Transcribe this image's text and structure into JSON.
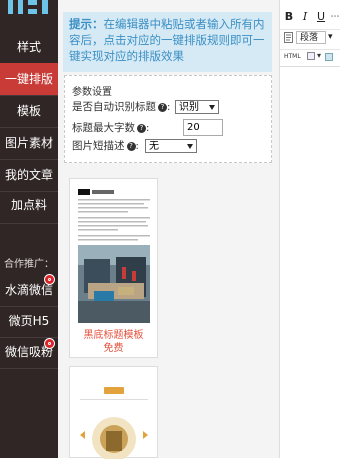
{
  "sidebar": {
    "nav": [
      "样式",
      "一键排版",
      "模板",
      "图片素材",
      "我的文章",
      "加点料"
    ],
    "active_index": 1,
    "partner_label": "合作推广：",
    "promos": [
      "水滴微信",
      "微页H5",
      "微信吸粉"
    ]
  },
  "tip": {
    "bold": "提示：",
    "text": "在编辑器中粘贴或者输入所有内容后，点击对应的一键排版规则即可一键实现对应的排版效果"
  },
  "params": {
    "title": "参数设置",
    "auto_title_label": "是否自动识别标题",
    "auto_title_value": "识别",
    "max_chars_label": "标题最大字数",
    "max_chars_value": "20",
    "img_desc_label": "图片短描述",
    "img_desc_value": "无"
  },
  "templates": [
    {
      "name": "黑底标题模板",
      "price": "免费"
    }
  ],
  "editor": {
    "bold": "B",
    "italic": "I",
    "underline": "U",
    "paragraph": "段落",
    "html_btn": "HTML"
  },
  "colors": {
    "sidebar_bg": "#2f2625",
    "active": "#c83b36",
    "tip_bg": "#d5eaf5",
    "tip_text": "#3b8fc5",
    "template_label": "#e4513c"
  }
}
